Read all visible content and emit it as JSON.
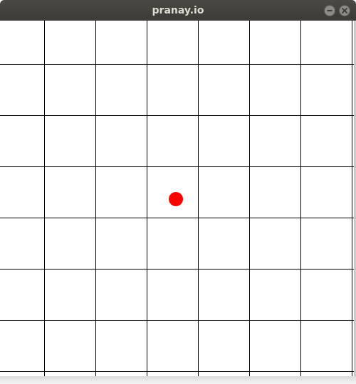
{
  "window": {
    "title": "pranay.io"
  },
  "icons": {
    "minimize": "minimize-icon",
    "close": "close-icon"
  },
  "game": {
    "grid": {
      "line_color": "#000000",
      "background": "#ffffff"
    },
    "dot": {
      "color": "#ff0000"
    }
  }
}
